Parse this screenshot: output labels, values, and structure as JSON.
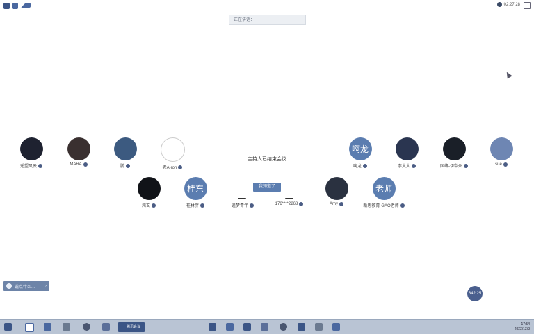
{
  "banner": {
    "text": "正在讲话："
  },
  "timer": {
    "time": "02:27:28"
  },
  "center": {
    "message": "主持人已结束会议",
    "button_label": "我知道了"
  },
  "participants_row1": [
    {
      "name": "遥望风云",
      "avatar_text": "",
      "color": "#1e2230"
    },
    {
      "name": "MARA",
      "avatar_text": "",
      "color": "#3a3030"
    },
    {
      "name": "鹏",
      "avatar_text": "",
      "color": "#3c5a80"
    },
    {
      "name": "老A-ron",
      "avatar_text": "",
      "color": "#ffffff"
    },
    {
      "name": "啊龙",
      "avatar_text": "啊龙",
      "color": "#5b7db0"
    },
    {
      "name": "李大大",
      "avatar_text": "",
      "color": "#2a3550"
    },
    {
      "name": "国峰-伊犁州",
      "avatar_text": "",
      "color": "#1a1f28"
    },
    {
      "name": "sue",
      "avatar_text": "",
      "color": "#6e86b3"
    }
  ],
  "participants_row2": [
    {
      "name": "鸿玄",
      "avatar_text": "",
      "color": "#111318"
    },
    {
      "name": "桂林胖",
      "avatar_text": "桂东",
      "color": "#5b7db0"
    },
    {
      "name": "追梦青年",
      "avatar_text": "",
      "color": ""
    },
    {
      "name": "176****2268",
      "avatar_text": "",
      "color": ""
    },
    {
      "name": "Amy",
      "avatar_text": "",
      "color": "#2a3140"
    },
    {
      "name": "新思教育-GAO老师",
      "avatar_text": "老师",
      "color": "#5b7db0"
    }
  ],
  "chat": {
    "placeholder": "说点什么..."
  },
  "zoom": {
    "label": "342.25"
  },
  "taskbar": {
    "app_label": "腾讯会议",
    "clock": "17:54",
    "date": "2022/12/3"
  }
}
